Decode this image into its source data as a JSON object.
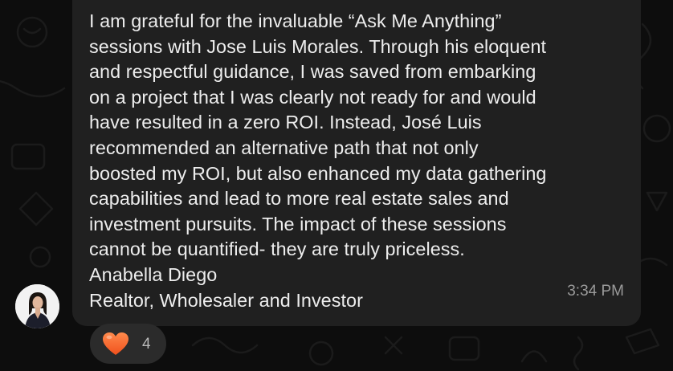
{
  "message": {
    "lines": [
      "I am grateful for the invaluable “Ask Me Anything”",
      "sessions with Jose Luis Morales. Through his eloquent",
      "and respectful guidance, I was saved from embarking",
      "on a project that I was clearly not ready for and would",
      "have resulted in a zero ROI. Instead, José Luis",
      "recommended an alternative path that not only",
      "boosted my ROI, but also enhanced my data gathering",
      "capabilities and lead to more real estate sales and",
      "investment pursuits. The impact of these sessions",
      "cannot be quantified- they are truly priceless.",
      "Anabella Diego",
      "Realtor, Wholesaler and Investor"
    ],
    "timestamp": "3:34 PM"
  },
  "sender": {
    "avatar_icon": "person-avatar-icon"
  },
  "reaction": {
    "emoji_icon": "heart-icon",
    "count": "4"
  },
  "colors": {
    "background": "#0d0d0d",
    "bubble": "#202020",
    "text": "#ededed",
    "timestamp": "#9a9a9a",
    "reaction_pill": "#2b2b2b",
    "heart": "#ff6b35"
  }
}
